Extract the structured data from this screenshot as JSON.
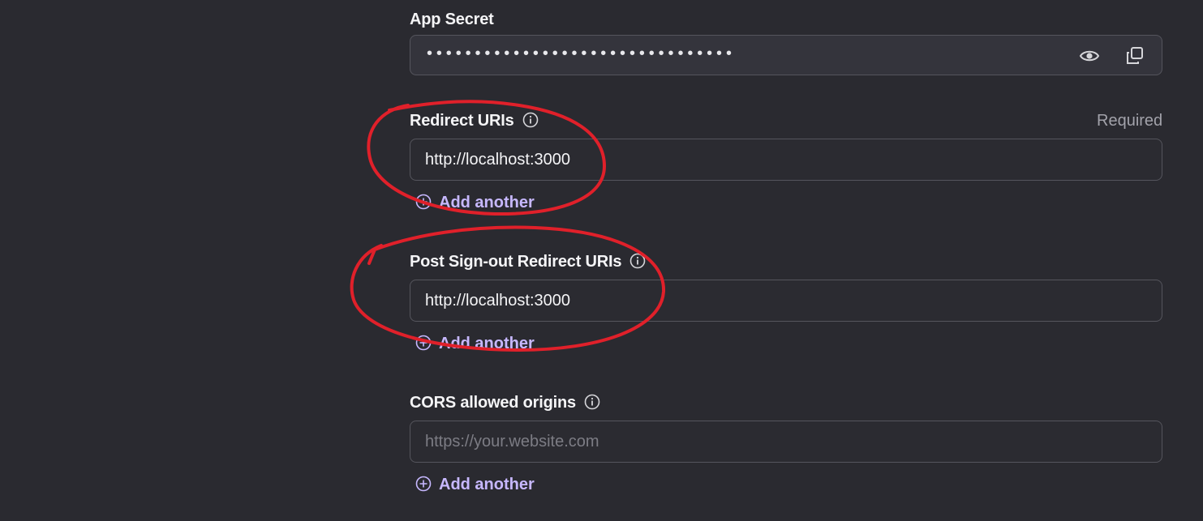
{
  "app_secret": {
    "label": "App Secret",
    "masked_value": "••••••••••••••••••••••••••••••••",
    "icons": [
      "eye-icon",
      "copy-icon"
    ]
  },
  "redirect_uris": {
    "label": "Redirect URIs",
    "required_text": "Required",
    "value": "http://localhost:3000",
    "add_label": "Add another"
  },
  "post_signout_uris": {
    "label": "Post Sign-out Redirect URIs",
    "value": "http://localhost:3000",
    "add_label": "Add another"
  },
  "cors": {
    "label": "CORS allowed origins",
    "placeholder": "https://your.website.com",
    "add_label": "Add another"
  },
  "colors": {
    "background": "#2a2a30",
    "accent_link": "#c7b8ff",
    "annotation": "#e0202a",
    "border": "#55555d"
  }
}
